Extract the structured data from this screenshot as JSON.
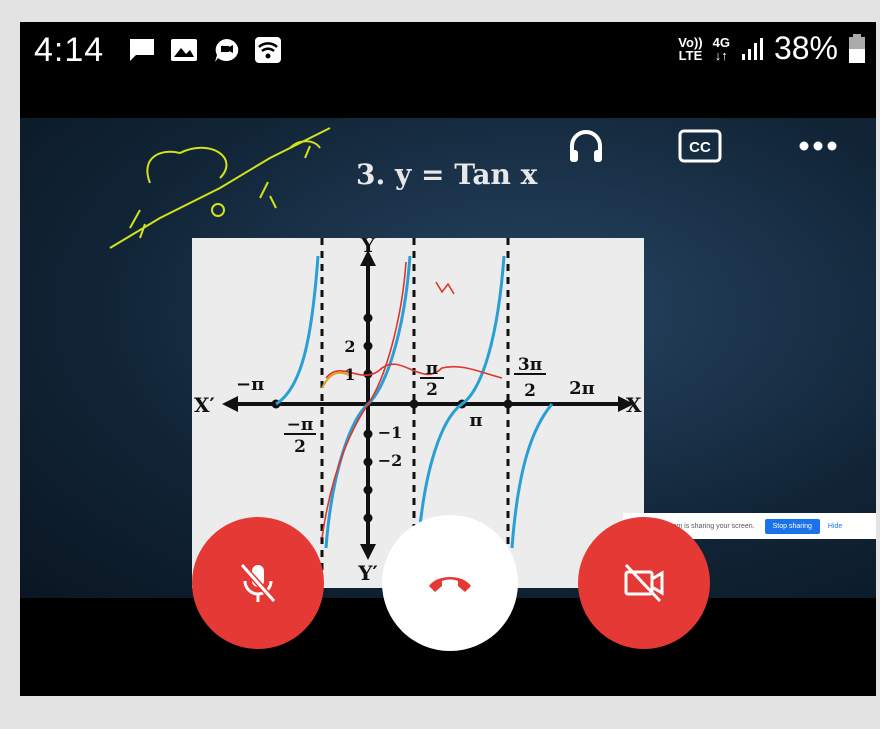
{
  "status_bar": {
    "time": "4:14",
    "network_volte": "Vo))",
    "network_lte": "LTE",
    "network_4g": "4G",
    "battery_percent": "38%"
  },
  "icons": {
    "status": [
      "message-icon",
      "image-icon",
      "chat-icon",
      "wifi-icon",
      "signal-icon",
      "battery-icon"
    ],
    "controls": [
      "headphones-icon",
      "closed-captions-icon",
      "more-icon"
    ],
    "call_buttons": [
      "mic-off-icon",
      "end-call-icon",
      "camera-off-icon"
    ]
  },
  "top_controls": {
    "cc_label": "CC"
  },
  "slide": {
    "title": "3. y = Tan x",
    "axis_x": "X",
    "axis_x_neg": "X′",
    "axis_y": "Y",
    "axis_y_neg": "Y′",
    "label_neg_pi": "−π",
    "label_neg_pi_over_2_num": "−π",
    "label_neg_pi_over_2_den": "2",
    "label_pi_over_2_num": "π",
    "label_pi_over_2_den": "2",
    "label_pi": "π",
    "label_3pi_over_2_num": "3π",
    "label_3pi_over_2_den": "2",
    "label_2pi": "2π",
    "label_y2": "2",
    "label_y1": "1",
    "label_yneg1": "−1",
    "label_yneg2": "−2"
  },
  "share_banner": {
    "text": "com is sharing your screen.",
    "stop_label": "Stop sharing",
    "hide_label": "Hide"
  },
  "colors": {
    "end_call_red": "#e53935",
    "curve_blue": "#2a9fd6",
    "annotation_yellow": "#d4e21a",
    "annotation_red": "#e0342a"
  }
}
